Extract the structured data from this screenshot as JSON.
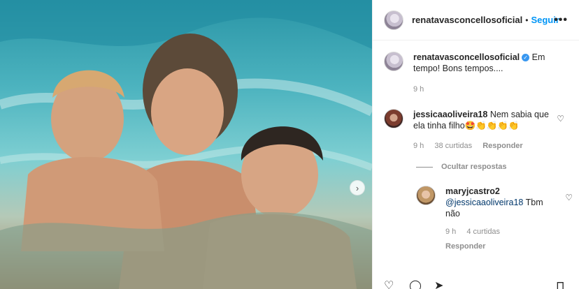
{
  "post": {
    "username": "renatavasconcellosoficial",
    "follow_label": "Seguir",
    "separator": "•",
    "more_label": "•••",
    "next_label": "›"
  },
  "caption": {
    "username": "renatavasconcellosoficial",
    "text": "Em tempo! Bons tempos....",
    "time": "9 h"
  },
  "comments": [
    {
      "username": "jessicaaoliveira18",
      "text": "Nem sabia que ela tinha filho🤩👏👏👏👏",
      "time": "9 h",
      "likes": "38 curtidas",
      "reply_label": "Responder"
    }
  ],
  "hide_replies_label": "Ocultar respostas",
  "reply": {
    "username": "maryjcastro2",
    "mention": "@jessicaaoliveira18",
    "text": "Tbm não",
    "time": "9 h",
    "likes": "4 curtidas",
    "reply_label": "Responder"
  },
  "icons": {
    "heart": "♡",
    "like_action": "♡",
    "comment_action": "◯",
    "share_action": "➤",
    "save_action": "⊓",
    "verified": "✓"
  },
  "colors": {
    "link_blue": "#0095f6",
    "verified_blue": "#3897f0",
    "muted": "#8e8e8e"
  }
}
